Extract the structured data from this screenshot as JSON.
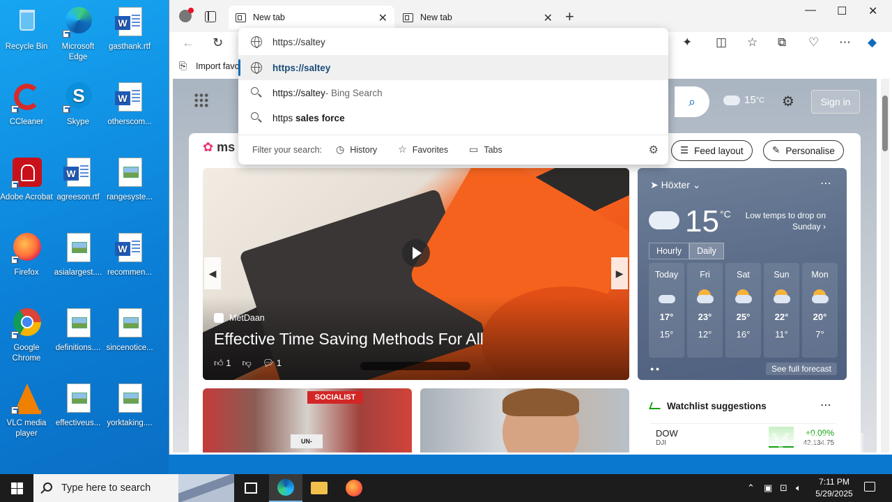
{
  "desktop": {
    "icons": [
      {
        "label": "Recycle Bin"
      },
      {
        "label": "Microsoft Edge"
      },
      {
        "label": "gasthank.rtf"
      },
      {
        "label": "CCleaner"
      },
      {
        "label": "Skype"
      },
      {
        "label": "otherscom..."
      },
      {
        "label": "Adobe Acrobat"
      },
      {
        "label": "agreeson.rtf"
      },
      {
        "label": "rangesyste..."
      },
      {
        "label": "Firefox"
      },
      {
        "label": "asialargest...."
      },
      {
        "label": "recommen..."
      },
      {
        "label": "Google Chrome"
      },
      {
        "label": "definitions...."
      },
      {
        "label": "sincenotice..."
      },
      {
        "label": "VLC media player"
      },
      {
        "label": "effectiveus..."
      },
      {
        "label": "yorktaking...."
      }
    ]
  },
  "browser": {
    "tabs": [
      {
        "label": "New tab",
        "close": "✕"
      },
      {
        "label": "New tab",
        "close": "✕"
      }
    ],
    "new_tab": "+",
    "window_controls": {
      "minimize": "—",
      "maximize": "☐",
      "close": "✕"
    },
    "toolbar": {
      "back": "←",
      "refresh": "↻"
    },
    "toolbar_icons": [
      "extensions-icon",
      "split-screen-icon",
      "favorites-icon",
      "collections-icon",
      "browser-essentials-icon",
      "more-icon",
      "copilot-icon"
    ],
    "favorites_bar": {
      "import": "Import favo"
    },
    "omnibox": {
      "input_value": "https://saltey",
      "suggestions": [
        {
          "text": "https://saltey",
          "type": "url",
          "selected": true
        },
        {
          "text": "https://saltey",
          "suffix": " - Bing Search",
          "type": "search"
        },
        {
          "prefix": "https ",
          "bold": "sales force",
          "type": "search"
        }
      ],
      "filter_label": "Filter your search:",
      "filters": [
        {
          "label": "History",
          "icon": "history-icon"
        },
        {
          "label": "Favorites",
          "icon": "star-icon"
        },
        {
          "label": "Tabs",
          "icon": "tabs-icon"
        }
      ]
    }
  },
  "page": {
    "header": {
      "weather_temp": "15",
      "weather_unit": "°C",
      "sign_in": "Sign in"
    },
    "feed": {
      "logo": "ms",
      "feed_layout": "Feed layout",
      "personalise": "Personalise"
    },
    "hero": {
      "source": "MetDaan",
      "title": "Effective Time Saving Methods For All",
      "likes": "1",
      "comments": "1"
    },
    "weather": {
      "location": "Höxter",
      "temp": "15",
      "unit": "°C",
      "note": "Low temps to drop on Sunday",
      "toggle": [
        "Hourly",
        "Daily"
      ],
      "days": [
        {
          "name": "Today",
          "hi": "17°",
          "lo": "15°",
          "icon": "cloud"
        },
        {
          "name": "Fri",
          "hi": "23°",
          "lo": "12°",
          "icon": "partly-sunny"
        },
        {
          "name": "Sat",
          "hi": "25°",
          "lo": "16°",
          "icon": "partly-sunny"
        },
        {
          "name": "Sun",
          "hi": "22°",
          "lo": "11°",
          "icon": "rain-sun"
        },
        {
          "name": "Mon",
          "hi": "20°",
          "lo": "7°",
          "icon": "partly-sunny"
        }
      ],
      "forecast_link": "See full forecast"
    },
    "cards": {
      "protest_sign": "UN-TRUMP",
      "protest_banner": "SOCIALIST"
    },
    "watchlist": {
      "title": "Watchlist suggestions",
      "rows": [
        {
          "symbol": "DOW",
          "sub": "DJI",
          "change": "+0.09%",
          "value": "42,134.75"
        }
      ]
    }
  },
  "taskbar": {
    "search_placeholder": "Type here to search",
    "time": "7:11 PM",
    "date": "5/29/2025"
  },
  "watermark": "ANY.RUN"
}
